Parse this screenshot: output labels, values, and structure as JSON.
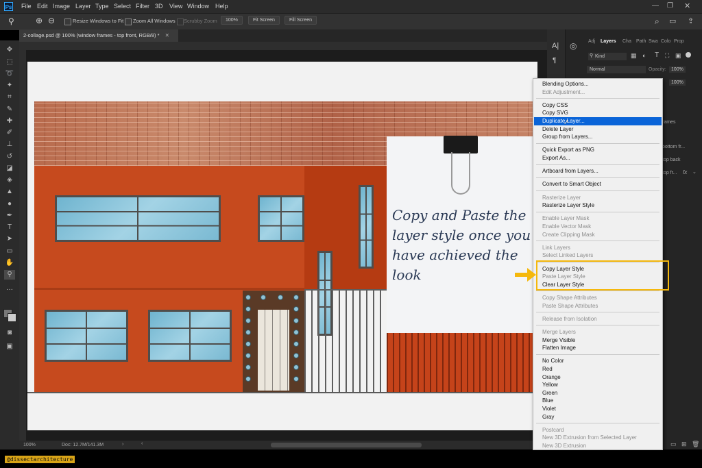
{
  "menubar": {
    "logo": "Ps",
    "items": [
      "File",
      "Edit",
      "Image",
      "Layer",
      "Type",
      "Select",
      "Filter",
      "3D",
      "View",
      "Window",
      "Help"
    ]
  },
  "options": {
    "resize_windows": "Resize Windows to Fit",
    "zoom_all": "Zoom All Windows",
    "scrubby_zoom": "Scrubby Zoom",
    "zoom_value": "100%",
    "fit_screen": "Fit Screen",
    "fill_screen": "Fill Screen"
  },
  "document": {
    "tab_title": "2-collage.psd @ 100% (window frames - top front, RGB/8) *",
    "zoom": "100%",
    "doc_info": "Doc: 12.7M/141.3M"
  },
  "note": {
    "text": "Copy and Paste the layer style once you have achieved the look"
  },
  "panels": {
    "tabs": [
      "Adj",
      "Layers",
      "Cha",
      "Path",
      "Swa",
      "Colo",
      "Prop"
    ],
    "kind": "Kind",
    "blend_mode": "Normal",
    "opacity_label": "Opacity:",
    "opacity_value": "100%",
    "fill_value": "100%",
    "layer_names": [
      "rames",
      "bottom fr...",
      "top back",
      "top fr..."
    ]
  },
  "context_menu": {
    "groups": [
      [
        {
          "label": "Blending Options...",
          "enabled": true
        },
        {
          "label": "Edit Adjustment...",
          "enabled": false
        }
      ],
      [
        {
          "label": "Copy CSS",
          "enabled": true
        },
        {
          "label": "Copy SVG",
          "enabled": true
        },
        {
          "label": "Duplicate Layer...",
          "enabled": true,
          "highlighted": true
        },
        {
          "label": "Delete Layer",
          "enabled": true
        },
        {
          "label": "Group from Layers...",
          "enabled": true
        }
      ],
      [
        {
          "label": "Quick Export as PNG",
          "enabled": true
        },
        {
          "label": "Export As...",
          "enabled": true
        }
      ],
      [
        {
          "label": "Artboard from Layers...",
          "enabled": true
        }
      ],
      [
        {
          "label": "Convert to Smart Object",
          "enabled": true
        }
      ],
      [
        {
          "label": "Rasterize Layer",
          "enabled": false
        },
        {
          "label": "Rasterize Layer Style",
          "enabled": true
        }
      ],
      [
        {
          "label": "Enable Layer Mask",
          "enabled": false
        },
        {
          "label": "Enable Vector Mask",
          "enabled": false
        },
        {
          "label": "Create Clipping Mask",
          "enabled": false
        }
      ],
      [
        {
          "label": "Link Layers",
          "enabled": false
        },
        {
          "label": "Select Linked Layers",
          "enabled": false
        }
      ],
      [
        {
          "label": "Copy Layer Style",
          "enabled": true
        },
        {
          "label": "Paste Layer Style",
          "enabled": false
        },
        {
          "label": "Clear Layer Style",
          "enabled": true
        }
      ],
      [
        {
          "label": "Copy Shape Attributes",
          "enabled": false
        },
        {
          "label": "Paste Shape Attributes",
          "enabled": false
        }
      ],
      [
        {
          "label": "Release from Isolation",
          "enabled": false
        }
      ],
      [
        {
          "label": "Merge Layers",
          "enabled": false
        },
        {
          "label": "Merge Visible",
          "enabled": true
        },
        {
          "label": "Flatten Image",
          "enabled": true
        }
      ],
      [
        {
          "label": "No Color",
          "enabled": true
        },
        {
          "label": "Red",
          "enabled": true
        },
        {
          "label": "Orange",
          "enabled": true
        },
        {
          "label": "Yellow",
          "enabled": true
        },
        {
          "label": "Green",
          "enabled": true
        },
        {
          "label": "Blue",
          "enabled": true
        },
        {
          "label": "Violet",
          "enabled": true
        },
        {
          "label": "Gray",
          "enabled": true
        }
      ],
      [
        {
          "label": "Postcard",
          "enabled": false
        },
        {
          "label": "New 3D Extrusion from Selected Layer",
          "enabled": false
        },
        {
          "label": "New 3D Extrusion",
          "enabled": false
        }
      ]
    ]
  },
  "watermark": "@dissectarchitecture",
  "colors": {
    "highlight_box": "#f5b80c",
    "menu_selection": "#0a64d8"
  }
}
